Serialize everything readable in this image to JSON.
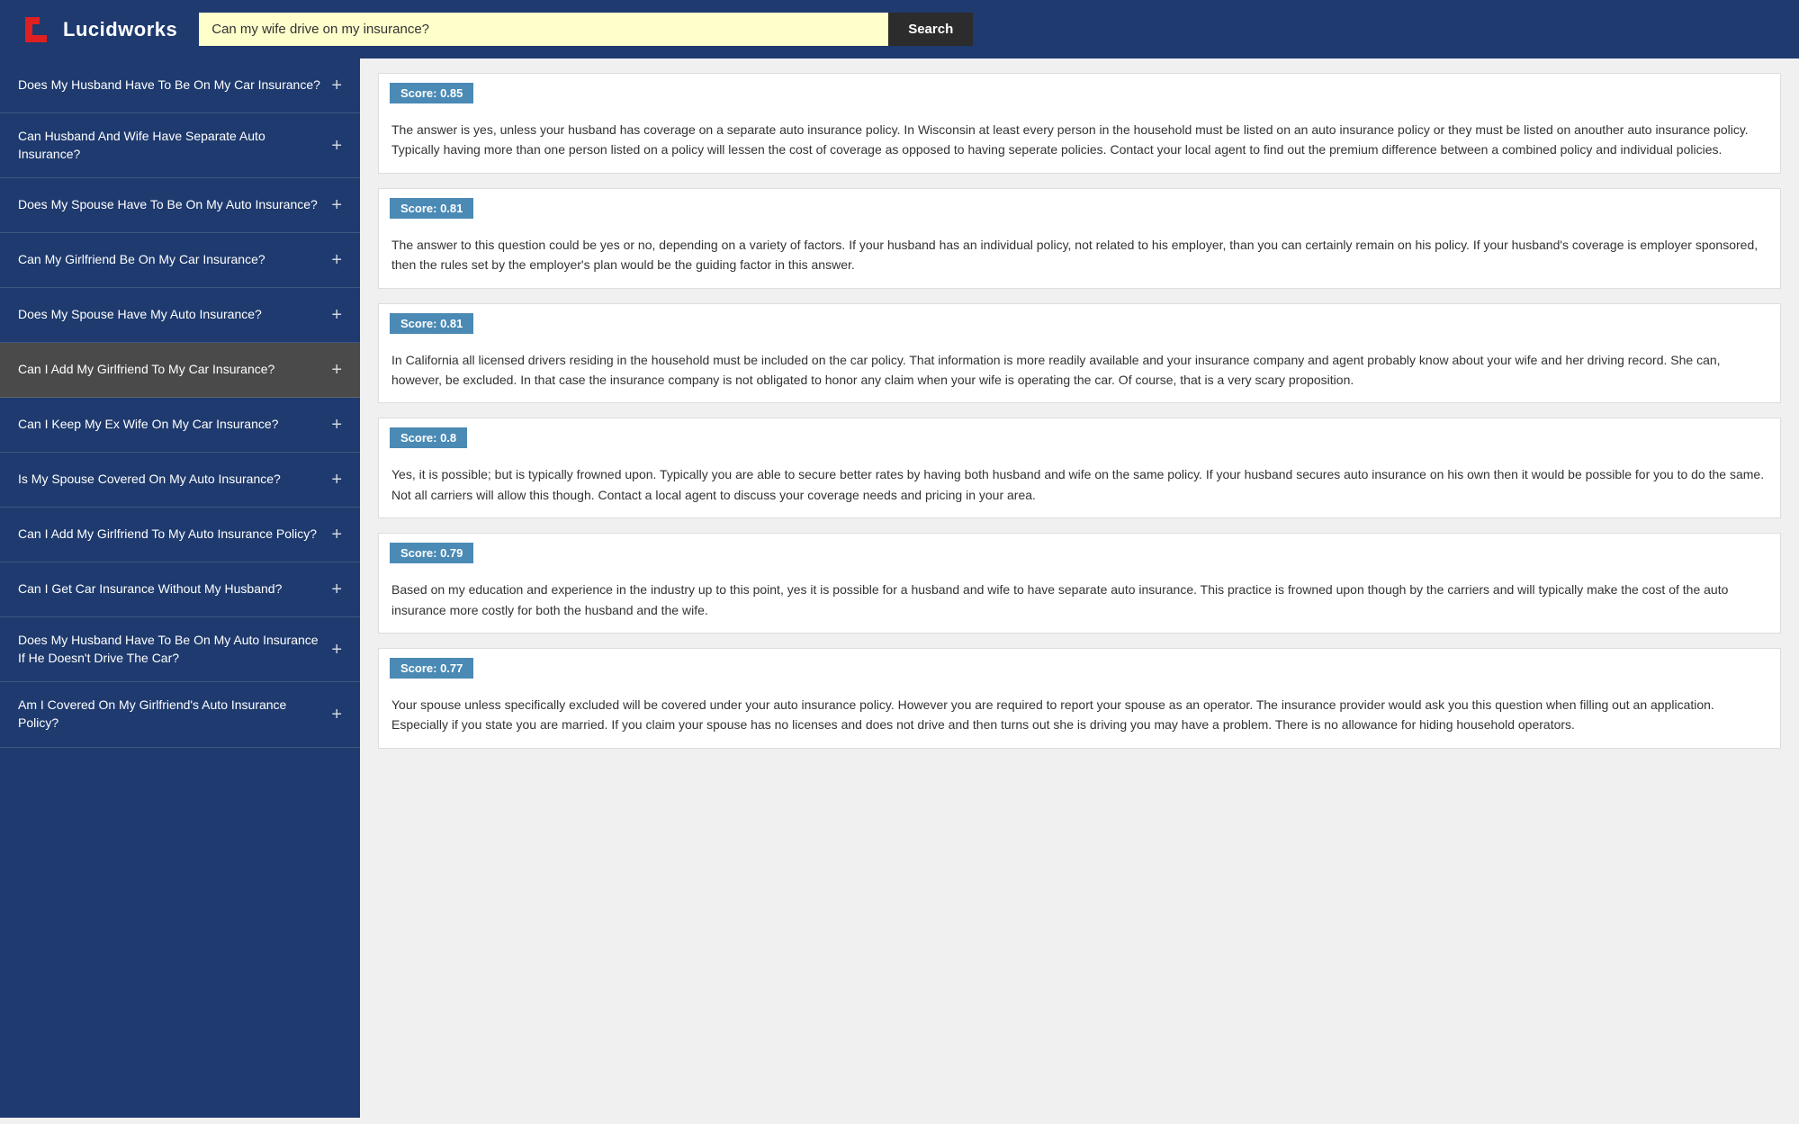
{
  "header": {
    "logo_text": "Lucidworks",
    "search_value": "Can my wife drive on my insurance?",
    "search_button_label": "Search"
  },
  "sidebar": {
    "items": [
      {
        "label": "Does My Husband Have To Be On My Car Insurance?",
        "active": false
      },
      {
        "label": "Can Husband And Wife Have Separate Auto Insurance?",
        "active": false
      },
      {
        "label": "Does My Spouse Have To Be On My Auto Insurance?",
        "active": false
      },
      {
        "label": "Can My Girlfriend Be On My Car Insurance?",
        "active": false
      },
      {
        "label": "Does My Spouse Have My Auto Insurance?",
        "active": false
      },
      {
        "label": "Can I Add My Girlfriend To My Car Insurance?",
        "active": true
      },
      {
        "label": "Can I Keep My Ex Wife On My Car Insurance?",
        "active": false
      },
      {
        "label": "Is My Spouse Covered On My Auto Insurance?",
        "active": false
      },
      {
        "label": "Can I Add My Girlfriend To My Auto Insurance Policy?",
        "active": false
      },
      {
        "label": "Can I Get Car Insurance Without My Husband?",
        "active": false
      },
      {
        "label": "Does My Husband Have To Be On My Auto Insurance If He Doesn't Drive The Car?",
        "active": false
      },
      {
        "label": "Am I Covered On My Girlfriend's Auto Insurance Policy?",
        "active": false
      }
    ],
    "plus_symbol": "+"
  },
  "results": [
    {
      "score": "Score: 0.85",
      "text": "The answer is yes, unless your husband has coverage on a separate auto insurance policy. In Wisconsin at least every person in the household must be listed on an auto insurance policy or they must be listed on anouther auto insurance policy. Typically having more than one person listed on a policy will lessen the cost of coverage as opposed to having seperate policies. Contact your local agent to find out the premium difference between a combined policy and individual policies."
    },
    {
      "score": "Score: 0.81",
      "text": "The answer to this question could be yes or no, depending on a variety of factors. If your husband has an individual policy, not related to his employer, than you can certainly remain on his policy. If your husband's coverage is employer sponsored, then the rules set by the employer's plan would be the guiding factor in this answer."
    },
    {
      "score": "Score: 0.81",
      "text": "In California all licensed drivers residing in the household must be included on the car policy. That information is more readily available and your insurance company and agent probably know about your wife and her driving record. She can, however, be excluded. In that case the insurance company is not obligated to honor any claim when your wife is operating the car. Of course, that is a very scary proposition."
    },
    {
      "score": "Score: 0.8",
      "text": "Yes, it is possible; but is typically frowned upon. Typically you are able to secure better rates by having both husband and wife on the same policy. If your husband secures auto insurance on his own then it would be possible for you to do the same. Not all carriers will allow this though. Contact a local agent to discuss your coverage needs and pricing in your area."
    },
    {
      "score": "Score: 0.79",
      "text": "Based on my education and experience in the industry up to this point, yes it is possible for a husband and wife to have separate auto insurance. This practice is frowned upon though by the carriers and will typically make the cost of the auto insurance more costly for both the husband and the wife."
    },
    {
      "score": "Score: 0.77",
      "text": "Your spouse unless specifically excluded will be covered under your auto insurance policy. However you are required to report your spouse as an operator. The insurance provider would ask you this question when filling out an application. Especially if you state you are married. If you claim your spouse has no licenses and does not drive and then turns out she is driving you may have a problem. There is no allowance for hiding household operators."
    }
  ]
}
